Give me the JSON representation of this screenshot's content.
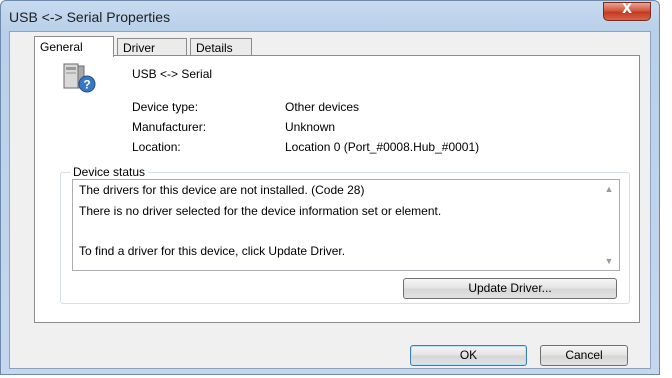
{
  "window": {
    "title": "USB <-> Serial Properties",
    "close_label": "X"
  },
  "tabs": [
    {
      "label": "General",
      "active": true
    },
    {
      "label": "Driver",
      "active": false
    },
    {
      "label": "Details",
      "active": false
    }
  ],
  "device": {
    "icon": "usb-serial-unknown-device-icon",
    "name": "USB <-> Serial",
    "properties": [
      {
        "label": "Device type:",
        "value": "Other devices"
      },
      {
        "label": "Manufacturer:",
        "value": "Unknown"
      },
      {
        "label": "Location:",
        "value": "Location 0 (Port_#0008.Hub_#0001)"
      }
    ]
  },
  "device_status": {
    "legend": "Device status",
    "lines": [
      "The drivers for this device are not installed. (Code 28)",
      "There is no driver selected for the device information set or element.",
      "To find a driver for this device, click Update Driver."
    ]
  },
  "buttons": {
    "update_driver": "Update Driver...",
    "ok": "OK",
    "cancel": "Cancel"
  }
}
